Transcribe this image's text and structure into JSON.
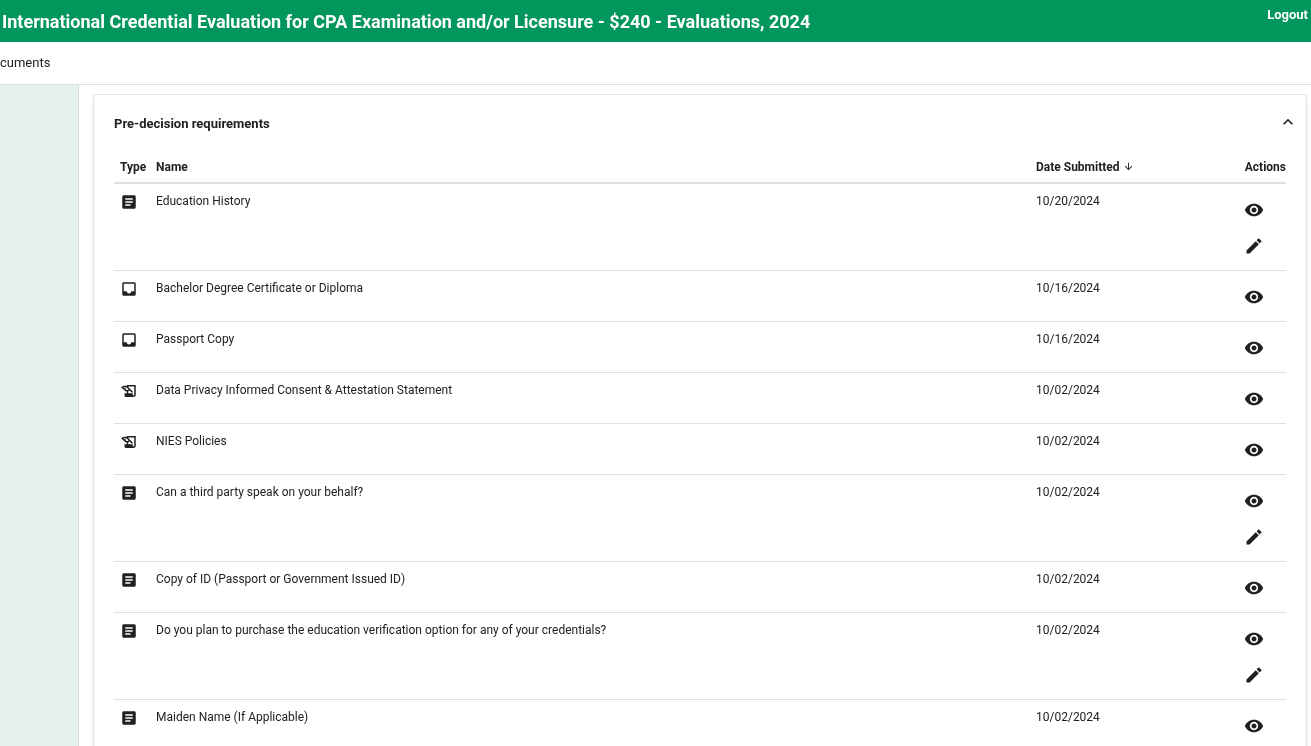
{
  "header": {
    "title": "International Credential Evaluation for CPA Examination and/or Licensure - $240 - Evaluations, 2024",
    "logout": "Logout"
  },
  "tab": {
    "label": "cuments"
  },
  "section": {
    "title": "Pre-decision requirements",
    "expanded": true
  },
  "table": {
    "columns": [
      "Type",
      "Name",
      "Date Submitted",
      "Actions"
    ],
    "rows": [
      {
        "kind": "form",
        "name": "Education History",
        "date": "10/20/2024",
        "editable": true
      },
      {
        "kind": "upload",
        "name": "Bachelor Degree Certificate or Diploma",
        "date": "10/16/2024",
        "editable": false
      },
      {
        "kind": "upload",
        "name": "Passport Copy",
        "date": "10/16/2024",
        "editable": false
      },
      {
        "kind": "signature",
        "name": "Data Privacy Informed Consent & Attestation Statement",
        "date": "10/02/2024",
        "editable": false
      },
      {
        "kind": "signature",
        "name": "NIES Policies",
        "date": "10/02/2024",
        "editable": false
      },
      {
        "kind": "form",
        "name": "Can a third party speak on your behalf?",
        "date": "10/02/2024",
        "editable": true
      },
      {
        "kind": "form",
        "name": "Copy of ID (Passport or Government Issued ID)",
        "date": "10/02/2024",
        "editable": false
      },
      {
        "kind": "form",
        "name": "Do you plan to purchase the education verification option for any of your credentials?",
        "date": "10/02/2024",
        "editable": true
      },
      {
        "kind": "form",
        "name": "Maiden Name (If Applicable)",
        "date": "10/02/2024",
        "editable": false
      }
    ]
  }
}
